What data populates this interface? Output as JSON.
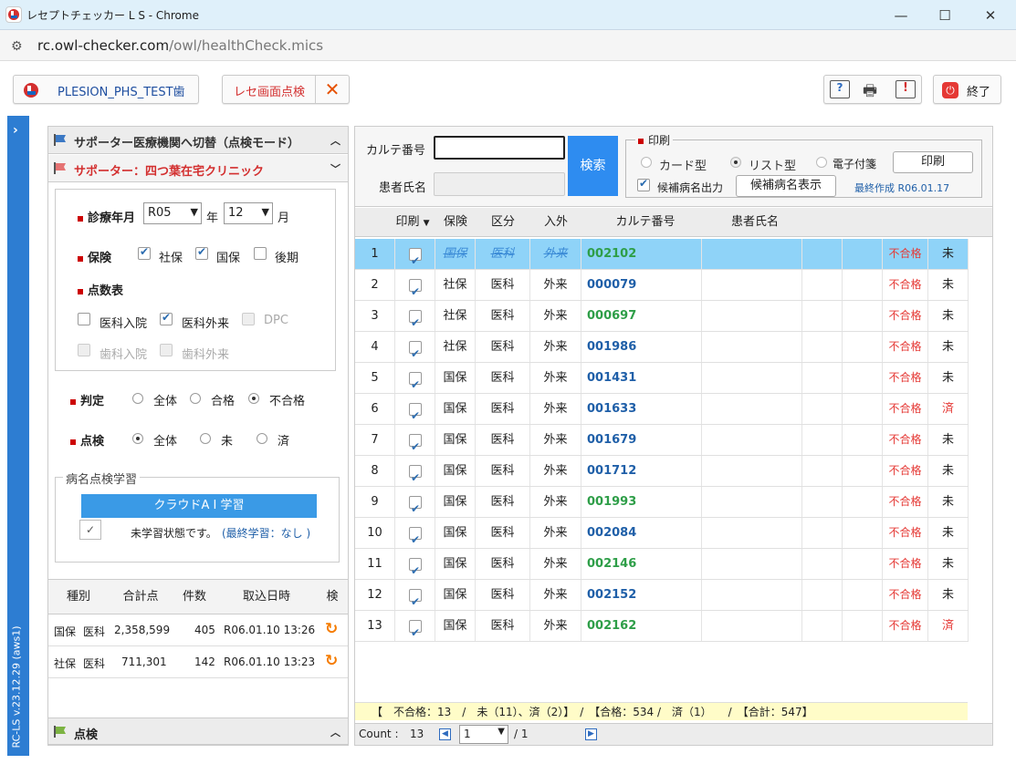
{
  "window": {
    "title": "レセプトチェッカー L S - Chrome",
    "url_host": "rc.owl-checker.com",
    "url_path": "/owl/healthCheck.mics"
  },
  "toolbar": {
    "clinic_code": "PLESION_PHS_TEST歯",
    "mode_button": "レセ画面点検",
    "exit_label": "終了"
  },
  "sidebar": {
    "version": "RC-LS v.23.12.29 (aws1)"
  },
  "left": {
    "switch_header": "サポーター医療機関へ切替（点検モード）",
    "supporter_header": "サポーター：四つ葉在宅クリニック",
    "shinryo_label": "診療年月",
    "year_value": "R05",
    "year_unit": "年",
    "month_value": "12",
    "month_unit": "月",
    "hoken_label": "保険",
    "shaho": "社保",
    "kokuho": "国保",
    "kouki": "後期",
    "tensu_label": "点数表",
    "ika_nyuin": "医科入院",
    "ika_gairai": "医科外来",
    "dpc": "DPC",
    "shika_nyuin": "歯科入院",
    "shika_gairai": "歯科外来",
    "hantei_label": "判定",
    "hantei_all": "全体",
    "hantei_pass": "合格",
    "hantei_fail": "不合格",
    "tenken_label": "点検",
    "tenken_all": "全体",
    "tenken_mi": "未",
    "tenken_zumi": "済",
    "learn_legend": "病名点検学習",
    "learn_button": "クラウドA I 学習",
    "learn_status": "未学習状態です。",
    "learn_last": "(最終学習：なし )",
    "table_headers": [
      "種別",
      "合計点",
      "件数",
      "取込日時",
      "検"
    ],
    "table_rows": [
      {
        "type1": "国保",
        "type2": "医科",
        "total": "2,358,599",
        "count": "405",
        "date": "R06.01.10 13:26"
      },
      {
        "type1": "社保",
        "type2": "医科",
        "total": "711,301",
        "count": "142",
        "date": "R06.01.10 13:23"
      }
    ],
    "footer": "点検"
  },
  "search": {
    "karte_label": "カルテ番号",
    "name_label": "患者氏名",
    "search_button": "検索"
  },
  "print": {
    "legend": "印刷",
    "card": "カード型",
    "list": "リスト型",
    "denshi": "電子付箋",
    "print_button": "印刷",
    "kouho_label": "候補病名出力",
    "kouho_button": "候補病名表示",
    "last_created": "最終作成 R06.01.17"
  },
  "grid": {
    "headers": {
      "print": "印刷",
      "hoken": "保険",
      "kubun": "区分",
      "nyugai": "入外",
      "karte": "カルテ番号",
      "name": "患者氏名"
    },
    "rows": [
      {
        "no": "1",
        "hoken": "国保",
        "kubun": "医科",
        "nyugai": "外来",
        "karte": "002102",
        "green": true,
        "result": "不合格",
        "status": "未",
        "selected": true
      },
      {
        "no": "2",
        "hoken": "社保",
        "kubun": "医科",
        "nyugai": "外来",
        "karte": "000079",
        "green": false,
        "result": "不合格",
        "status": "未"
      },
      {
        "no": "3",
        "hoken": "社保",
        "kubun": "医科",
        "nyugai": "外来",
        "karte": "000697",
        "green": true,
        "result": "不合格",
        "status": "未"
      },
      {
        "no": "4",
        "hoken": "社保",
        "kubun": "医科",
        "nyugai": "外来",
        "karte": "001986",
        "green": false,
        "result": "不合格",
        "status": "未"
      },
      {
        "no": "5",
        "hoken": "国保",
        "kubun": "医科",
        "nyugai": "外来",
        "karte": "001431",
        "green": false,
        "result": "不合格",
        "status": "未"
      },
      {
        "no": "6",
        "hoken": "国保",
        "kubun": "医科",
        "nyugai": "外来",
        "karte": "001633",
        "green": false,
        "result": "不合格",
        "status": "済"
      },
      {
        "no": "7",
        "hoken": "国保",
        "kubun": "医科",
        "nyugai": "外来",
        "karte": "001679",
        "green": false,
        "result": "不合格",
        "status": "未"
      },
      {
        "no": "8",
        "hoken": "国保",
        "kubun": "医科",
        "nyugai": "外来",
        "karte": "001712",
        "green": false,
        "result": "不合格",
        "status": "未"
      },
      {
        "no": "9",
        "hoken": "国保",
        "kubun": "医科",
        "nyugai": "外来",
        "karte": "001993",
        "green": true,
        "result": "不合格",
        "status": "未"
      },
      {
        "no": "10",
        "hoken": "国保",
        "kubun": "医科",
        "nyugai": "外来",
        "karte": "002084",
        "green": false,
        "result": "不合格",
        "status": "未"
      },
      {
        "no": "11",
        "hoken": "国保",
        "kubun": "医科",
        "nyugai": "外来",
        "karte": "002146",
        "green": true,
        "result": "不合格",
        "status": "未"
      },
      {
        "no": "12",
        "hoken": "国保",
        "kubun": "医科",
        "nyugai": "外来",
        "karte": "002152",
        "green": false,
        "result": "不合格",
        "status": "未"
      },
      {
        "no": "13",
        "hoken": "国保",
        "kubun": "医科",
        "nyugai": "外来",
        "karte": "002162",
        "green": true,
        "result": "不合格",
        "status": "済"
      }
    ],
    "summary": "【　不合格：13　/　未（11）、済（2）】　/　【合格：534 /　済（1）　　/　【合計：547】",
    "count_label": "Count :",
    "count_value": "13",
    "page_value": "1",
    "page_total": "/ 1"
  },
  "colors": {
    "accent": "#2e8cf0",
    "selected_row": "#8fd3f8",
    "fail_red": "#e53935",
    "karte_blue": "#1f5fa8",
    "karte_green": "#2e9e48"
  }
}
